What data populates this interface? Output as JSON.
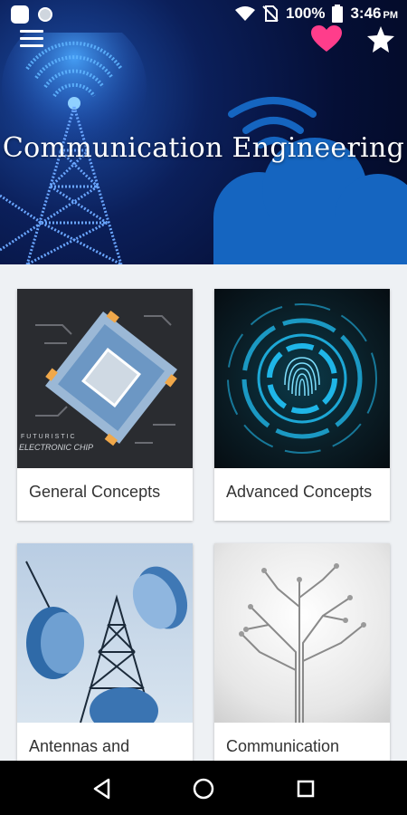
{
  "status_bar": {
    "battery": "100%",
    "time": "3:46",
    "time_suffix": "PM"
  },
  "header": {
    "title": "Communication Engineering"
  },
  "cards": [
    {
      "label": "General Concepts",
      "image_text_1": "FUTURISTIC",
      "image_text_2": "ELECTRONIC CHIP"
    },
    {
      "label": "Advanced Concepts"
    },
    {
      "label": "Antennas and"
    },
    {
      "label": "Communication"
    }
  ],
  "colors": {
    "accent_heart": "#ff3d8b",
    "banner_dark": "#050f36",
    "cloud_blue": "#1565c0"
  },
  "icons": {
    "menu": "hamburger-icon",
    "favorite": "heart-icon",
    "rate": "star-icon",
    "back": "back-triangle-icon",
    "home": "home-circle-icon",
    "recents": "recents-square-icon"
  }
}
